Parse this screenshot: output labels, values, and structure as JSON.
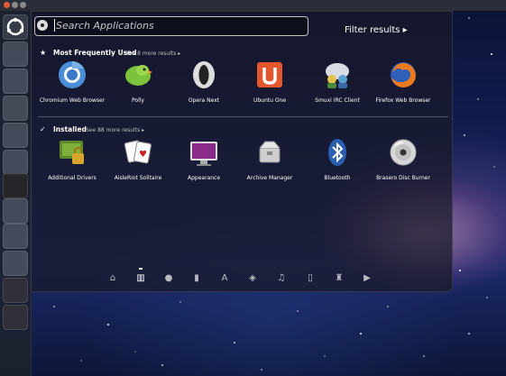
{
  "search": {
    "placeholder": "Search Applications"
  },
  "filter": {
    "label": "Filter results",
    "arrow": "▸"
  },
  "sections": {
    "frequent": {
      "title": "Most Frequently Used",
      "more": "See 8 more results",
      "more_arrow": "▸",
      "apps": [
        {
          "label": "Chromium Web Browser",
          "icon": "chromium-icon"
        },
        {
          "label": "Polly",
          "icon": "polly-icon"
        },
        {
          "label": "Opera Next",
          "icon": "opera-icon"
        },
        {
          "label": "Ubuntu One",
          "icon": "ubuntu-one-icon"
        },
        {
          "label": "Smuxi IRC Client",
          "icon": "smuxi-icon"
        },
        {
          "label": "Firefox Web Browser",
          "icon": "firefox-icon"
        }
      ]
    },
    "installed": {
      "title": "Installed",
      "more": "See 88 more results",
      "more_arrow": "▸",
      "apps": [
        {
          "label": "Additional Drivers",
          "icon": "drivers-icon"
        },
        {
          "label": "AisleRiot Solitaire",
          "icon": "solitaire-icon"
        },
        {
          "label": "Appearance",
          "icon": "appearance-icon"
        },
        {
          "label": "Archive Manager",
          "icon": "archive-icon"
        },
        {
          "label": "Bluetooth",
          "icon": "bluetooth-icon"
        },
        {
          "label": "Brasero Disc Burner",
          "icon": "brasero-icon"
        }
      ]
    }
  },
  "lenses": [
    "home-lens-icon",
    "applications-lens-icon",
    "social-lens-icon",
    "files-lens-icon",
    "fonts-lens-icon",
    "photos-lens-icon",
    "music-lens-icon",
    "documents-lens-icon",
    "tools-lens-icon",
    "video-lens-icon"
  ],
  "colors": {
    "accent": "#e2572b",
    "dash_bg": "#19192a"
  }
}
